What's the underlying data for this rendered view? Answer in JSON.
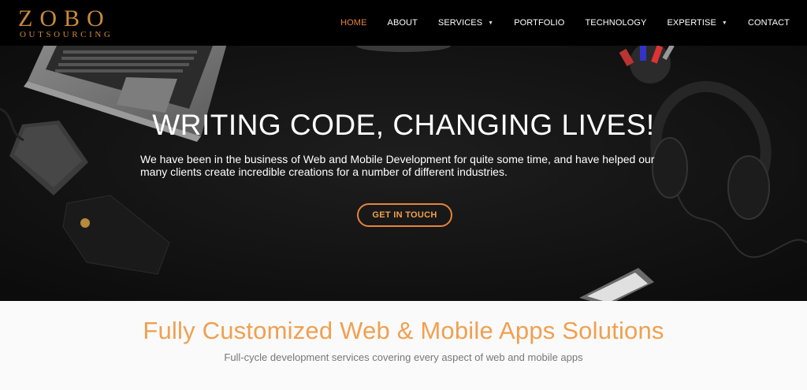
{
  "brand": {
    "name": "ZOBO",
    "tagline": "OUTSOURCING",
    "color": "#c98a3a"
  },
  "nav": {
    "items": [
      {
        "label": "HOME",
        "active": true
      },
      {
        "label": "ABOUT"
      },
      {
        "label": "SERVICES",
        "dropdown": true
      },
      {
        "label": "PORTFOLIO"
      },
      {
        "label": "TECHNOLOGY"
      },
      {
        "label": "EXPERTISE",
        "dropdown": true
      },
      {
        "label": "CONTACT"
      }
    ],
    "dropdown_icon": "chevron-down-icon",
    "active_color": "#e8833a"
  },
  "hero": {
    "title": "WRITING CODE, CHANGING LIVES!",
    "text": "We have been in the business of Web and Mobile Development for quite some time, and have helped our many clients create incredible creations for a number of different industries.",
    "cta_label": "GET IN TOUCH",
    "accent_color": "#e8833a"
  },
  "section": {
    "title": "Fully Customized Web & Mobile Apps Solutions",
    "subtitle": "Full-cycle development services covering every aspect of web and mobile apps",
    "title_color": "#f0a050"
  }
}
